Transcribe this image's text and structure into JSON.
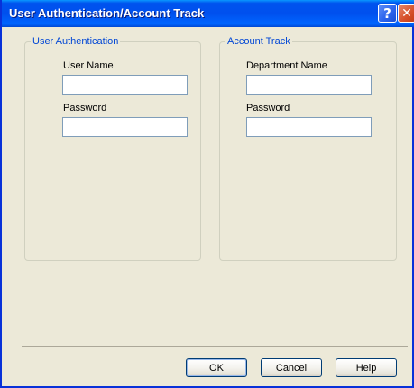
{
  "window": {
    "title": "User Authentication/Account Track"
  },
  "titlebar_buttons": {
    "help_glyph": "?",
    "close_glyph": "✕",
    "help_icon": "question-icon",
    "close_icon": "close-icon"
  },
  "user_authentication": {
    "legend": "User Authentication",
    "user_name_label": "User Name",
    "user_name_value": "",
    "password_label": "Password",
    "password_value": ""
  },
  "account_track": {
    "legend": "Account Track",
    "department_name_label": "Department Name",
    "department_name_value": "",
    "password_label": "Password",
    "password_value": ""
  },
  "buttons": {
    "ok": "OK",
    "cancel": "Cancel",
    "help": "Help"
  },
  "colors": {
    "titlebar": "#0053ee",
    "group_legend": "#0046d5",
    "dialog_background": "#ece9d8"
  }
}
